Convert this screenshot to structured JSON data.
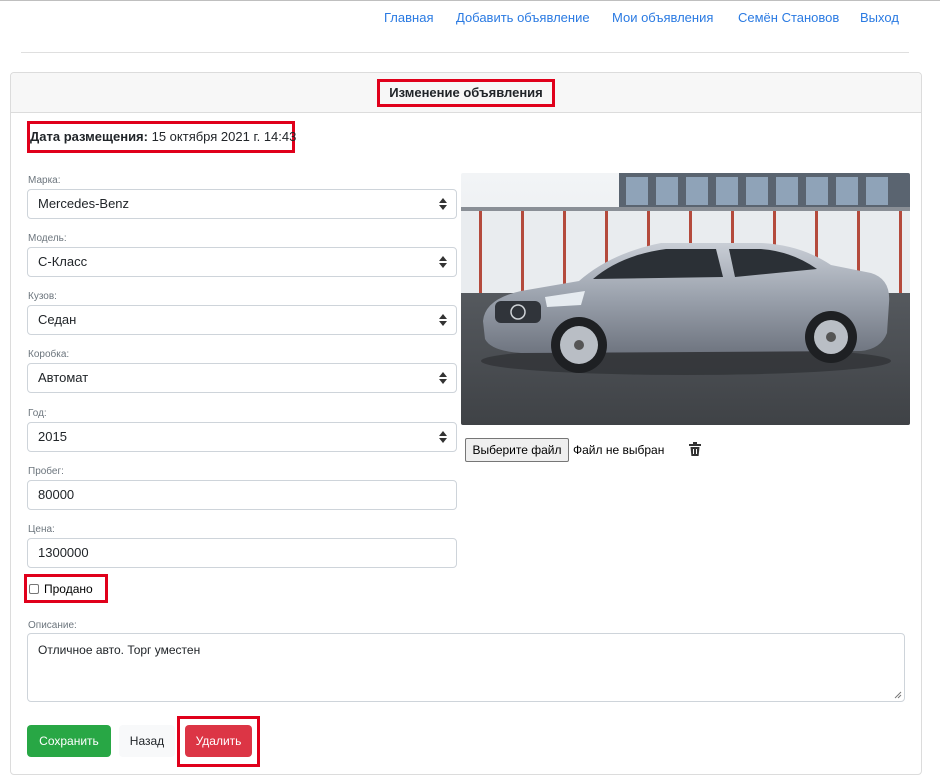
{
  "nav": {
    "items": [
      "Главная",
      "Добавить объявление",
      "Мои объявления",
      "Семён Становов",
      "Выход"
    ]
  },
  "card": {
    "title": "Изменение объявления",
    "date_label": "Дата размещения:",
    "date_value": "15 октября 2021 г. 14:43"
  },
  "form": {
    "brand": {
      "label": "Марка:",
      "value": "Mercedes-Benz"
    },
    "model": {
      "label": "Модель:",
      "value": "C-Класс"
    },
    "body": {
      "label": "Кузов:",
      "value": "Седан"
    },
    "gearbox": {
      "label": "Коробка:",
      "value": "Автомат"
    },
    "year": {
      "label": "Год:",
      "value": "2015"
    },
    "mileage": {
      "label": "Пробег:",
      "value": "80000"
    },
    "price": {
      "label": "Цена:",
      "value": "1300000"
    },
    "sold": {
      "label": "Продано",
      "checked": false
    },
    "description": {
      "label": "Описание:",
      "value": "Отличное авто. Торг уместен"
    }
  },
  "photo": {
    "file_button": "Выберите файл",
    "file_status": "Файл не выбран"
  },
  "buttons": {
    "save": "Сохранить",
    "back": "Назад",
    "delete": "Удалить"
  },
  "colors": {
    "link": "#2a7ae2",
    "highlight": "#e0001b",
    "save": "#28a745",
    "delete": "#dc3545"
  },
  "icons": {
    "delete_photo": "trash-icon"
  }
}
